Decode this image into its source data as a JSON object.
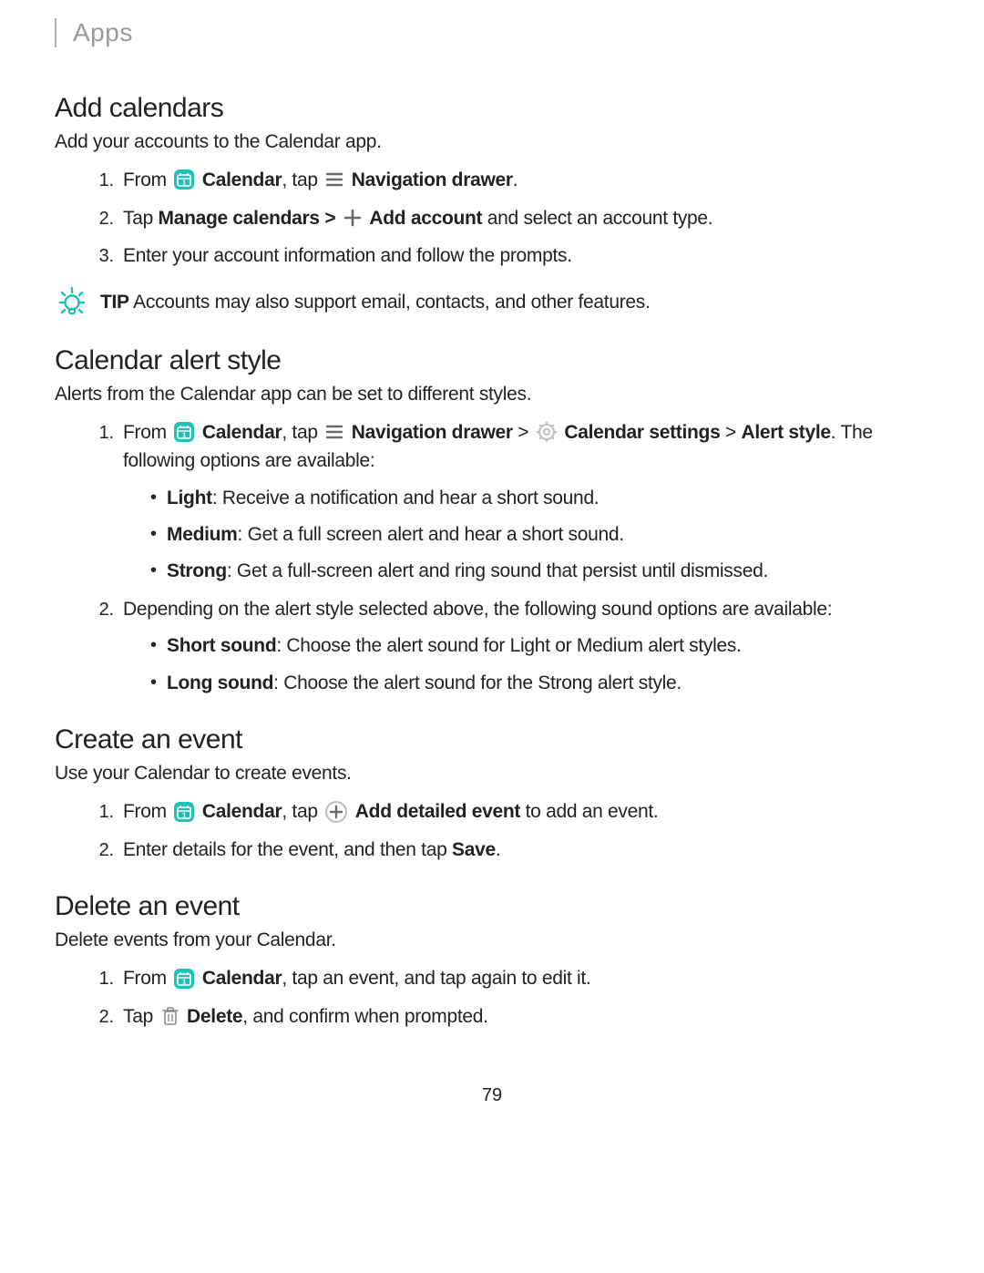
{
  "breadcrumb": "Apps",
  "page_number": "79",
  "sections": {
    "add_calendars": {
      "heading": "Add calendars",
      "intro": "Add your accounts to the Calendar app.",
      "step1_a": "From ",
      "step1_b": "Calendar",
      "step1_c": ", tap ",
      "step1_d": "Navigation drawer",
      "step1_e": ".",
      "step2_a": "Tap ",
      "step2_b": "Manage calendars > ",
      "step2_c": " Add account",
      "step2_d": " and select an account type.",
      "step3": "Enter your account information and follow the prompts.",
      "tip_label": "TIP",
      "tip_text": "  Accounts may also support email, contacts, and other features."
    },
    "alert_style": {
      "heading": "Calendar alert style",
      "intro": "Alerts from the Calendar app can be set to different styles.",
      "s1_a": "From ",
      "s1_b": "Calendar",
      "s1_c": ", tap ",
      "s1_d": "Navigation drawer",
      "s1_e": " > ",
      "s1_f": "Calendar settings",
      "s1_g": " > ",
      "s1_h": "Alert style",
      "s1_i": ". The following options are available:",
      "light_b": "Light",
      "light_t": ": Receive a notification and hear a short sound.",
      "medium_b": "Medium",
      "medium_t": ": Get a full screen alert and hear a short sound.",
      "strong_b": "Strong",
      "strong_t": ": Get a full-screen alert and ring sound that persist until dismissed.",
      "s2": "Depending on the alert style selected above, the following sound options are available:",
      "short_b": "Short sound",
      "short_t": ": Choose the alert sound for Light or Medium alert styles.",
      "long_b": "Long sound",
      "long_t": ": Choose the alert sound for the Strong alert style."
    },
    "create_event": {
      "heading": "Create an event",
      "intro": "Use your Calendar to create events.",
      "s1_a": "From ",
      "s1_b": "Calendar",
      "s1_c": ", tap ",
      "s1_d": "Add detailed event",
      "s1_e": " to add an event.",
      "s2_a": "Enter details for the event, and then tap ",
      "s2_b": "Save",
      "s2_c": "."
    },
    "delete_event": {
      "heading": "Delete an event",
      "intro": "Delete events from your Calendar.",
      "s1_a": "From ",
      "s1_b": "Calendar",
      "s1_c": ", tap an event, and tap again to edit it.",
      "s2_a": "Tap ",
      "s2_b": "Delete",
      "s2_c": ", and confirm when prompted."
    }
  }
}
